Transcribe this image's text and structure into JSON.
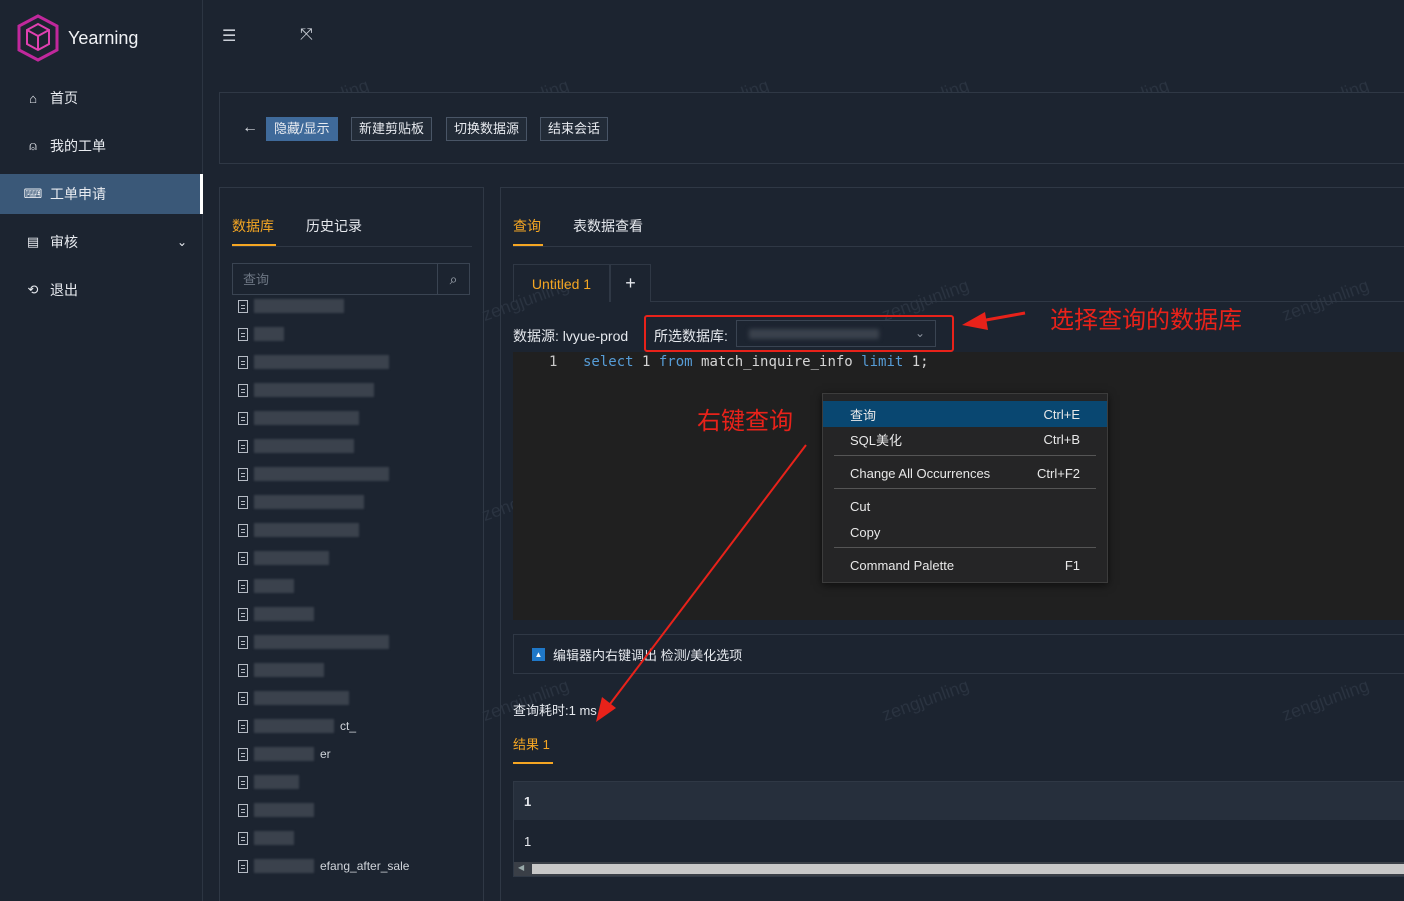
{
  "app": {
    "name": "Yearning"
  },
  "sidebar": {
    "items": [
      {
        "label": "首页",
        "icon": "home-icon",
        "glyph": "⌂"
      },
      {
        "label": "我的工单",
        "icon": "user-icon",
        "glyph": "⍝"
      },
      {
        "label": "工单申请",
        "icon": "terminal-icon",
        "glyph": "⌨"
      },
      {
        "label": "审核",
        "icon": "audit-icon",
        "glyph": "▤"
      },
      {
        "label": "退出",
        "icon": "logout-icon",
        "glyph": "⟲"
      }
    ],
    "active_index": 2
  },
  "toolbar": {
    "buttons": [
      "隐藏/显示",
      "新建剪贴板",
      "切换数据源",
      "结束会话"
    ]
  },
  "left_panel": {
    "tabs": [
      "数据库",
      "历史记录"
    ],
    "search_placeholder": "查询",
    "tree_text": {
      "row_16": "ct_",
      "row_17": "er",
      "last": "efang_after_sale"
    }
  },
  "right_panel": {
    "tabs": [
      "查询",
      "表数据查看"
    ],
    "editor_tabs": [
      "Untitled 1",
      "+"
    ],
    "datasource_label": "数据源:",
    "datasource_value": "lvyue-prod",
    "selected_db_label": "所选数据库:",
    "editor": {
      "line_number": "1",
      "code": {
        "kw1": "select",
        "n1": " 1 ",
        "kw2": "from",
        "tbl": " match_inquire_info ",
        "kw3": "limit",
        "n2": " 1;"
      }
    },
    "context_menu": [
      {
        "label": "查询",
        "shortcut": "Ctrl+E"
      },
      {
        "label": "SQL美化",
        "shortcut": "Ctrl+B"
      },
      {
        "label": "Change All Occurrences",
        "shortcut": "Ctrl+F2"
      },
      {
        "label": "Cut",
        "shortcut": ""
      },
      {
        "label": "Copy",
        "shortcut": ""
      },
      {
        "label": "Command Palette",
        "shortcut": "F1"
      }
    ],
    "collapse_label": "编辑器内右键调出 检测/美化选项",
    "query_time": "查询耗时:1 ms",
    "result_tab": "结果 1",
    "result_table": {
      "header": "1",
      "rows": [
        "1"
      ]
    }
  },
  "annotations": {
    "select_db": "选择查询的数据库",
    "right_click": "右键查询"
  },
  "watermark": "zengjunling",
  "colors": {
    "accent": "#f5a623",
    "annotation": "#e8221a",
    "active_nav": "#3a5878",
    "primary_button": "#3f6a9a"
  }
}
